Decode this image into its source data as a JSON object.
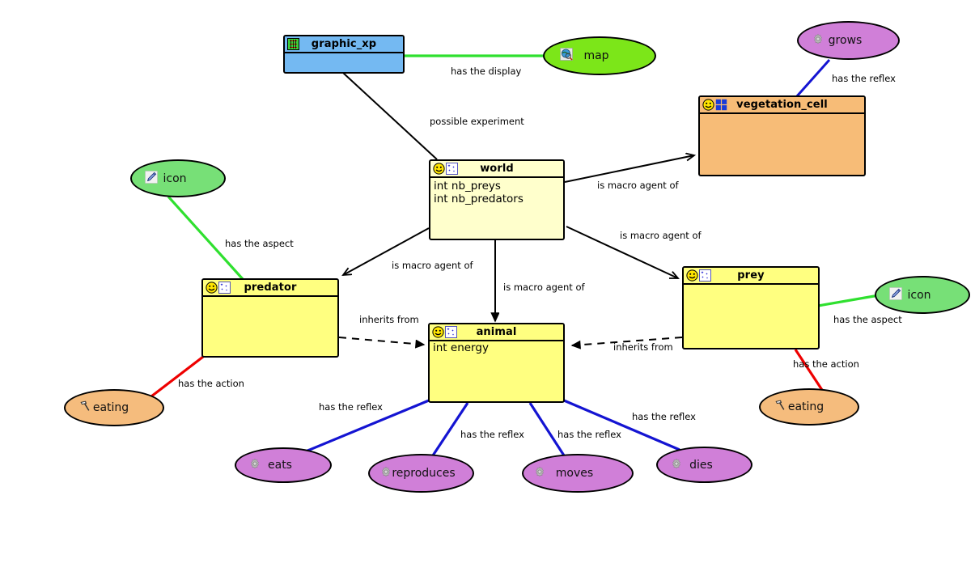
{
  "diagram": {
    "title": "predator-prey model diagram",
    "colors": {
      "class_yellow": "#ffff80",
      "class_pale_yellow": "#ffffcc",
      "class_blue": "#74b9f2",
      "class_orange": "#f7bc77",
      "ellipse_green_light": "#77e077",
      "ellipse_green_bright": "#7ce619",
      "ellipse_purple": "#d07fd8",
      "ellipse_orange": "#f5bc7d",
      "edge_black": "#000000",
      "edge_green": "#2fe02f",
      "edge_blue": "#1414d2",
      "edge_red": "#ee0000"
    }
  },
  "nodes": {
    "graphic_xp": {
      "label": "graphic_xp",
      "kind": "class",
      "icons": [
        "chart-grid-icon"
      ],
      "attributes": []
    },
    "world": {
      "label": "world",
      "kind": "class",
      "icons": [
        "smiley-icon",
        "species-icon"
      ],
      "attributes": [
        "int nb_preys",
        "int nb_predators"
      ]
    },
    "vegetation_cell": {
      "label": "vegetation_cell",
      "kind": "class",
      "icons": [
        "smiley-icon",
        "grid-icon"
      ],
      "attributes": []
    },
    "predator": {
      "label": "predator",
      "kind": "class",
      "icons": [
        "smiley-icon",
        "species-icon"
      ],
      "attributes": []
    },
    "prey": {
      "label": "prey",
      "kind": "class",
      "icons": [
        "smiley-icon",
        "species-icon"
      ],
      "attributes": []
    },
    "animal": {
      "label": "animal",
      "kind": "class",
      "icons": [
        "smiley-icon",
        "species-icon"
      ],
      "attributes": [
        "int energy"
      ]
    },
    "map": {
      "label": "map",
      "kind": "display",
      "icon": "map-globe-icon"
    },
    "grows": {
      "label": "grows",
      "kind": "reflex",
      "icon": "gear-icon"
    },
    "icon_left": {
      "label": "icon",
      "kind": "aspect",
      "icon": "pen-icon"
    },
    "icon_right": {
      "label": "icon",
      "kind": "aspect",
      "icon": "pen-icon"
    },
    "eating_left": {
      "label": "eating",
      "kind": "action",
      "icon": "hammer-icon"
    },
    "eating_right": {
      "label": "eating",
      "kind": "action",
      "icon": "hammer-icon"
    },
    "eats": {
      "label": "eats",
      "kind": "reflex",
      "icon": "gear-icon"
    },
    "reproduces": {
      "label": "reproduces",
      "kind": "reflex",
      "icon": "gear-icon"
    },
    "moves": {
      "label": "moves",
      "kind": "reflex",
      "icon": "gear-icon"
    },
    "dies": {
      "label": "dies",
      "kind": "reflex",
      "icon": "gear-icon"
    }
  },
  "edge_labels": {
    "has_the_display": "has the display",
    "has_the_reflex_grows": "has the reflex",
    "possible_experiment": "possible experiment",
    "is_macro_agent_of_vegetation": "is macro agent of",
    "is_macro_agent_of_prey": "is macro agent of",
    "is_macro_agent_of_predator": "is macro agent of",
    "is_macro_agent_of_animal": "is macro agent of",
    "has_the_aspect_left": "has the aspect",
    "has_the_aspect_right": "has the aspect",
    "inherits_from_left": "inherits from",
    "inherits_from_right": "inherits from",
    "has_the_action_left": "has the action",
    "has_the_action_right": "has the action",
    "has_the_reflex_eats": "has the reflex",
    "has_the_reflex_reproduces": "has the reflex",
    "has_the_reflex_moves": "has the reflex",
    "has_the_reflex_dies": "has the reflex"
  }
}
